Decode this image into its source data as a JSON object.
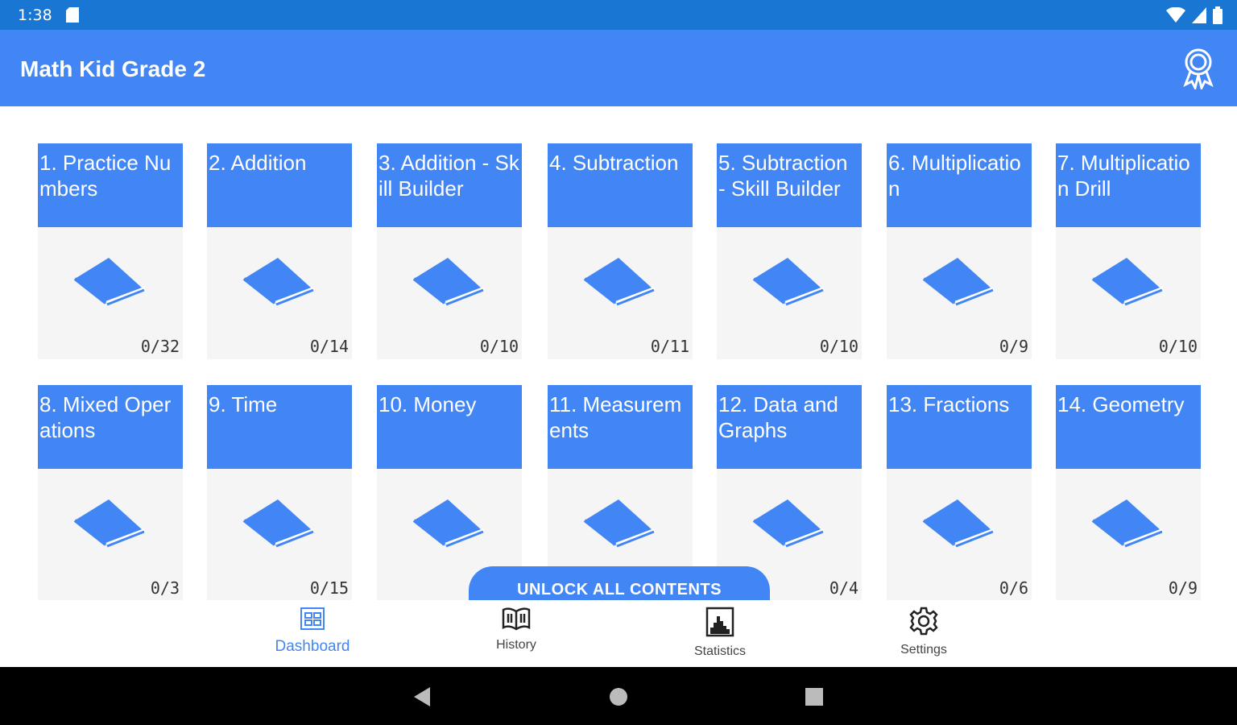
{
  "status": {
    "time": "1:38"
  },
  "app": {
    "title": "Math Kid Grade 2"
  },
  "lessons": [
    {
      "title": "1. Practice Numbers",
      "progress": "0/32"
    },
    {
      "title": "2. Addition",
      "progress": "0/14"
    },
    {
      "title": "3. Addition - Skill Builder",
      "progress": "0/10"
    },
    {
      "title": "4. Subtraction",
      "progress": "0/11"
    },
    {
      "title": "5. Subtraction - Skill Builder",
      "progress": "0/10"
    },
    {
      "title": "6. Multiplication",
      "progress": "0/9"
    },
    {
      "title": "7. Multiplication Drill",
      "progress": "0/10"
    },
    {
      "title": "8. Mixed Operations",
      "progress": "0/3"
    },
    {
      "title": "9. Time",
      "progress": "0/15"
    },
    {
      "title": "10. Money",
      "progress": ""
    },
    {
      "title": "11. Measurements",
      "progress": ""
    },
    {
      "title": "12. Data and Graphs",
      "progress": "0/4"
    },
    {
      "title": "13. Fractions",
      "progress": "0/6"
    },
    {
      "title": "14. Geometry",
      "progress": "0/9"
    }
  ],
  "unlock_label": "UNLOCK ALL CONTENTS",
  "nav": {
    "dashboard": "Dashboard",
    "history": "History",
    "statistics": "Statistics",
    "settings": "Settings"
  },
  "colors": {
    "primary": "#4286f5",
    "statusbar": "#1976d2",
    "card_bg": "#f5f5f5"
  }
}
